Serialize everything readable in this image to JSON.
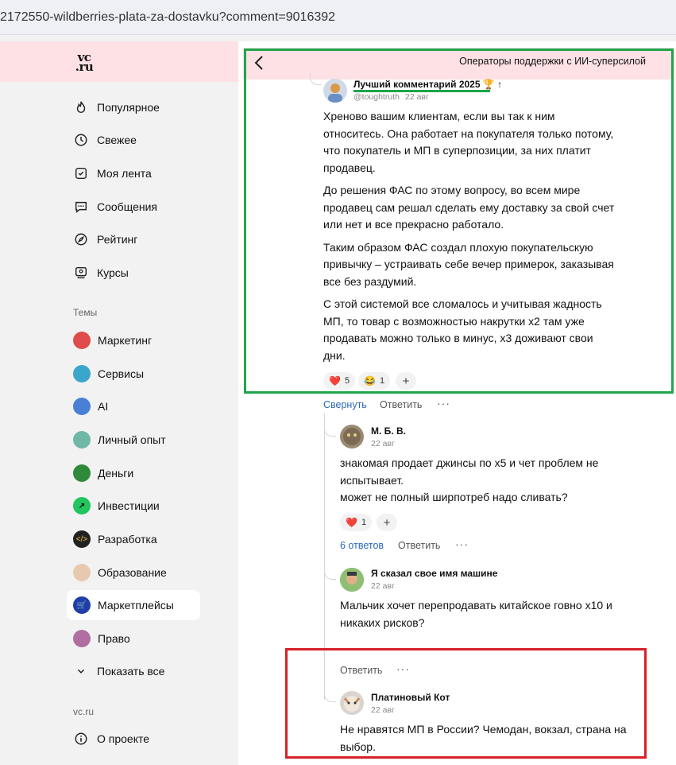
{
  "browser": {
    "url": "2172550-wildberries-plata-za-dostavku?comment=9016392"
  },
  "site": {
    "logo": "vc\n.ru"
  },
  "sidebar": {
    "nav": [
      {
        "label": "Популярное",
        "icon": "fire-icon"
      },
      {
        "label": "Свежее",
        "icon": "clock-icon"
      },
      {
        "label": "Моя лента",
        "icon": "feed-icon"
      },
      {
        "label": "Сообщения",
        "icon": "chat-icon"
      },
      {
        "label": "Рейтинг",
        "icon": "compass-icon"
      },
      {
        "label": "Курсы",
        "icon": "courses-icon"
      }
    ],
    "topics_label": "Темы",
    "topics": [
      {
        "label": "Маркетинг",
        "color": "#e04b4b"
      },
      {
        "label": "Сервисы",
        "color": "#3aa6c9"
      },
      {
        "label": "AI",
        "color": "#4a7fd6"
      },
      {
        "label": "Личный опыт",
        "color": "#6fb8a8"
      },
      {
        "label": "Деньги",
        "color": "#2f8a3c"
      },
      {
        "label": "Инвестиции",
        "color": "#22c55e"
      },
      {
        "label": "Разработка",
        "color": "#222222"
      },
      {
        "label": "Образование",
        "color": "#e8c9b0"
      },
      {
        "label": "Маркетплейсы",
        "color": "#1f3fa8",
        "selected": true
      },
      {
        "label": "Право",
        "color": "#b06fa0"
      }
    ],
    "show_all": "Показать все",
    "footer_label": "vc.ru",
    "about": "О проекте"
  },
  "header": {
    "title": "Операторы поддержки с ИИ-суперсилой"
  },
  "comments": [
    {
      "author": "Лучший комментарий 2025 🏆 ↑",
      "handle": "@toughtruth",
      "date": "22 авг",
      "paragraphs": [
        "Хреново вашим клиентам, если вы так к ним относитесь. Она работает на покупателя только потому, что покупатель и МП в суперпозиции, за них платит продавец.",
        "До решения ФАС по этому вопросу, во всем мире продавец сам решал сделать ему доставку за свой счет или нет и все прекрасно работало.",
        "Таким образом ФАС создал плохую покупательскую привычку – устраивать себе вечер примерок, заказывая все без раздумий.",
        "С этой системой все сломалось и учитывая жадность МП, то товар с возможностью накрутки х2 там уже продавать можно только в минус, х3 доживают свои дни."
      ],
      "reactions": [
        {
          "emoji": "❤️",
          "count": "5"
        },
        {
          "emoji": "😂",
          "count": "1"
        }
      ],
      "actions": {
        "collapse": "Свернуть",
        "reply": "Ответить",
        "more": "···"
      }
    },
    {
      "author": "М. Б. В.",
      "date": "22 авг",
      "paragraphs": [
        "знакомая продает джинсы по х5 и чет проблем не испытывает.\nможет не полный ширпотреб надо сливать?"
      ],
      "reactions": [
        {
          "emoji": "❤️",
          "count": "1"
        }
      ],
      "actions": {
        "replies": "6 ответов",
        "reply": "Ответить",
        "more": "···"
      }
    },
    {
      "author": "Я сказал свое имя машине",
      "date": "22 авг",
      "paragraphs": [
        "Мальчик хочет перепродавать китайское говно х10 и никаких рисков?"
      ],
      "actions": {
        "reply": "Ответить",
        "more": "···"
      }
    },
    {
      "author": "Платиновый Кот",
      "date": "22 авг",
      "paragraphs": [
        "Не нравятся МП в России? Чемодан, вокзал, страна на выбор."
      ]
    }
  ],
  "colors": {
    "accent_blue": "#2b69b8",
    "highlight_green": "#1fa64a",
    "highlight_red": "#d62128",
    "header_pink": "#fde1e4"
  }
}
